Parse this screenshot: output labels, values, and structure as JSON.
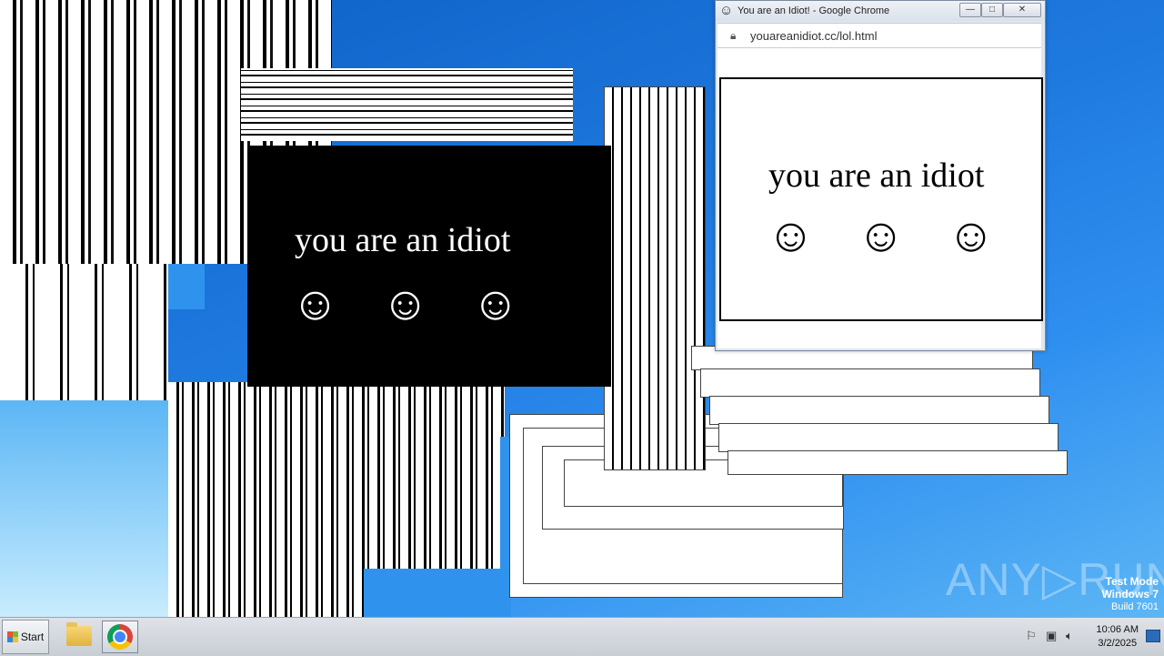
{
  "browser_window": {
    "title": "You are an Idiot! - Google Chrome",
    "url": "youareanidiot.cc/lol.html",
    "controls": {
      "minimize": "—",
      "maximize": "□",
      "close": "✕"
    }
  },
  "popup_white": {
    "message": "you are an idiot",
    "smileys": [
      "☺",
      "☺",
      "☺"
    ]
  },
  "popup_black": {
    "message": "you are an idiot",
    "smileys": [
      "☺",
      "☺",
      "☺"
    ]
  },
  "watermark": {
    "text": "ANY▷RUN"
  },
  "test_mode": {
    "line1": "Test Mode",
    "line2": "Windows 7",
    "line3": "Build 7601"
  },
  "taskbar": {
    "start_label": "Start",
    "apps": [
      {
        "name": "Windows Explorer",
        "icon": "folder-icon"
      },
      {
        "name": "Google Chrome",
        "icon": "chrome-icon"
      }
    ],
    "tray_icons": [
      "flag-icon",
      "network-icon",
      "volume-icon"
    ],
    "clock_time": "10:06 AM",
    "clock_date": "3/2/2025"
  },
  "colors": {
    "desktop": "#1f7ae0",
    "taskbar": "#d3d8de",
    "popup_black_bg": "#000000",
    "popup_white_bg": "#ffffff"
  }
}
